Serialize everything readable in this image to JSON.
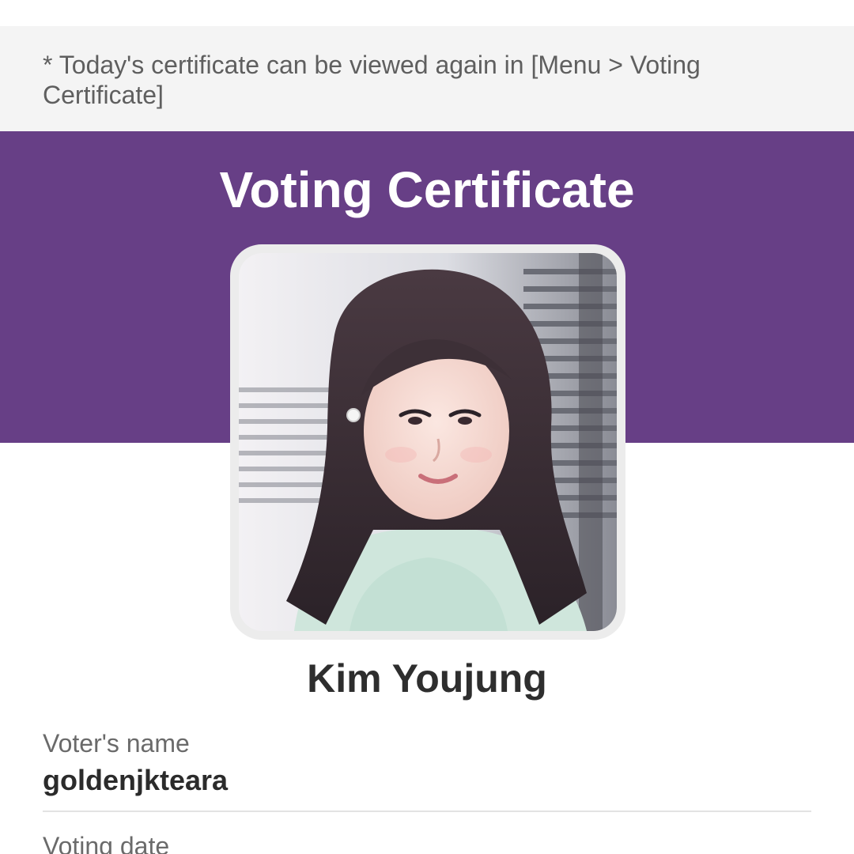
{
  "notice": {
    "text": "* Today's certificate can be viewed again in [Menu > Voting Certificate]"
  },
  "certificate": {
    "title": "Voting Certificate",
    "idol_name": "Kim Youjung",
    "photo_alt": "Kim Youjung"
  },
  "fields": [
    {
      "label": "Voter's name",
      "value": "goldenjkteara"
    },
    {
      "label": "Voting date",
      "value": ""
    }
  ],
  "colors": {
    "banner": "#673f86",
    "notice_bg": "#f4f4f4",
    "frame": "#ececec"
  }
}
